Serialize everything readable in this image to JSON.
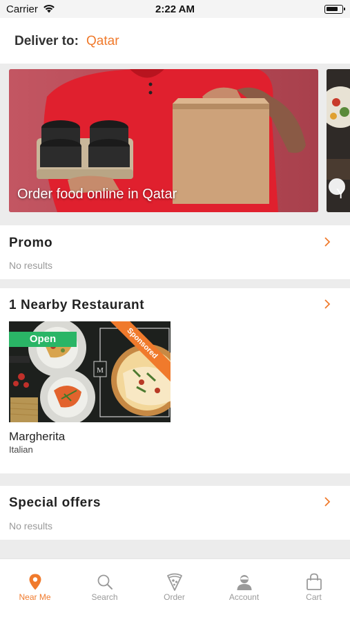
{
  "status_bar": {
    "carrier": "Carrier",
    "time": "2:22 AM"
  },
  "header": {
    "deliver_label": "Deliver to:",
    "location": "Qatar"
  },
  "banner": {
    "title": "Order food online in Qatar",
    "next_title": "Y"
  },
  "promo": {
    "title": "Promo",
    "empty_text": "No results"
  },
  "nearby": {
    "title": "1 Nearby Restaurant",
    "restaurants": [
      {
        "name": "Margherita",
        "cuisine": "Italian",
        "status": "Open",
        "badge": "Sponsored",
        "logo_letter": "M"
      }
    ]
  },
  "special_offers": {
    "title": "Special offers",
    "empty_text": "No results"
  },
  "tab_bar": {
    "active_color": "#f07a2c",
    "inactive_color": "#9a9a9a",
    "tabs": [
      {
        "label": "Near Me",
        "icon": "location-pin-icon",
        "active": true
      },
      {
        "label": "Search",
        "icon": "search-icon",
        "active": false
      },
      {
        "label": "Order",
        "icon": "pizza-slice-icon",
        "active": false
      },
      {
        "label": "Account",
        "icon": "user-icon",
        "active": false
      },
      {
        "label": "Cart",
        "icon": "shopping-bag-icon",
        "active": false
      }
    ]
  },
  "colors": {
    "accent": "#f07a2c",
    "open_badge": "#2ab566",
    "background": "#ececec"
  }
}
